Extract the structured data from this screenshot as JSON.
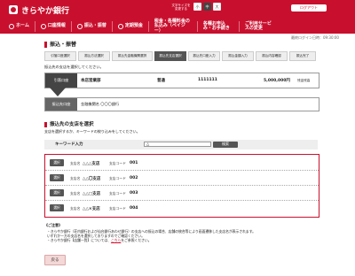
{
  "header": {
    "bank_name": "きらやか銀行",
    "font_size_label": "文字サイズを変更する",
    "font_sizes": [
      "小",
      "中",
      "大"
    ],
    "logout_label": "ログアウト",
    "nav": [
      {
        "label": "ホーム",
        "icon": "home-icon"
      },
      {
        "label": "口座情報",
        "icon": "account-icon"
      },
      {
        "label": "振込・振替",
        "icon": "transfer-icon"
      },
      {
        "label": "定期預金",
        "icon": "deposit-icon"
      },
      {
        "label": "税金・各種料金の払込み（ペイジー）",
        "icon": "payment-icon"
      },
      {
        "label": "各種お申込み・お手続き",
        "icon": "application-icon"
      },
      {
        "label": "ご利用サービスの変更",
        "icon": "service-icon"
      }
    ]
  },
  "last_login": "最終ログイン日時：09:30:00",
  "page_title": "振込・振替",
  "steps": [
    "引落口座選択",
    "振込方法選択",
    "振込先金融機関選択",
    "振込先支店選択",
    "振込先口座入力",
    "振込金額入力",
    "振込内容確認",
    "振込完了"
  ],
  "intro_text": "振込先の支店を選択してください。",
  "from_account": {
    "label": "引落口座",
    "branch": "本店営業部",
    "type": "普通",
    "number": "1111111",
    "balance": "5,000,000円",
    "balance_label": "残金残高"
  },
  "to_account": {
    "label": "振込先口座",
    "bank": "金融機関名  〇〇〇銀行"
  },
  "branch_section": {
    "title": "振込先の支店を選択",
    "subtitle": "支店を選択するか、キーワードの絞り込みをしてください。",
    "keyword_label": "キーワード入力",
    "keyword_value": "△",
    "search_label": "検索"
  },
  "results": [
    {
      "select": "選択",
      "name_label": "支店名",
      "name": "△△△支店",
      "code_label": "支店コード",
      "code": "001"
    },
    {
      "select": "選択",
      "name_label": "支店名",
      "name": "△△〇支店",
      "code_label": "支店コード",
      "code": "002"
    },
    {
      "select": "選択",
      "name_label": "支店名",
      "name": "△△□支店",
      "code_label": "支店コード",
      "code": "003"
    },
    {
      "select": "選択",
      "name_label": "支店名",
      "name": "△△×支店",
      "code_label": "支店コード",
      "code": "004"
    }
  ],
  "notes": {
    "title": "《ご注意》",
    "items": [
      "きらやか銀行（荘内銀行および仙台銀行あわせ銀行）の支店への振込の場合、店舗の統合等により画面遷移した支店名が表示されます。",
      "いずれか一方の支店名を選択しておりますのでご確認ください。",
      "きらやか銀行【店舗一覧】については、"
    ],
    "link_text": "こちら",
    "link_suffix": "をご参照ください。"
  },
  "back_label": "戻る",
  "colors": {
    "brand": "#c8102e",
    "dark": "#444444"
  }
}
